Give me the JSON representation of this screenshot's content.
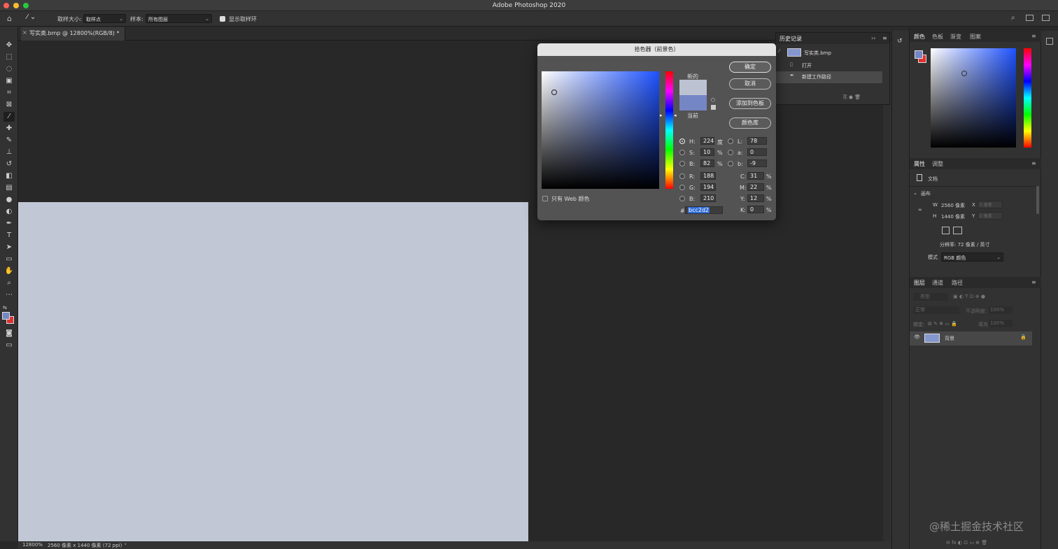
{
  "app": {
    "title": "Adobe Photoshop 2020"
  },
  "options_bar": {
    "sample_size_label": "取样大小:",
    "sample_size_value": "取样点",
    "sample_label": "样本:",
    "sample_value": "所有图层",
    "show_ring_label": "显示取样环"
  },
  "document": {
    "tab_label": "写实类.bmp @ 12800%(RGB/8) *",
    "fill_color": "#c1c7d5"
  },
  "status": {
    "zoom": "12800%",
    "size": "2560 像素 x 1440 像素 (72 ppi)",
    "arrow": "›"
  },
  "history": {
    "title": "历史记录",
    "snapshot": "写实类.bmp",
    "items": [
      {
        "label": "打开"
      },
      {
        "label": "新建工作路径"
      }
    ]
  },
  "color_picker": {
    "title": "拾色器（前景色）",
    "new_label": "新的",
    "current_label": "当前",
    "new_color": "#bcc2d2",
    "current_color": "#7586c5",
    "ok": "确定",
    "cancel": "取消",
    "add_swatch": "添加到色板",
    "color_libraries": "颜色库",
    "web_only": "只有 Web 颜色",
    "fields": {
      "H": {
        "label": "H:",
        "value": "224",
        "unit": "度"
      },
      "S": {
        "label": "S:",
        "value": "10",
        "unit": "%"
      },
      "Bv": {
        "label": "B:",
        "value": "82",
        "unit": "%"
      },
      "R": {
        "label": "R:",
        "value": "188"
      },
      "G": {
        "label": "G:",
        "value": "194"
      },
      "B": {
        "label": "B:",
        "value": "210"
      },
      "L": {
        "label": "L:",
        "value": "78"
      },
      "a": {
        "label": "a:",
        "value": "0"
      },
      "b": {
        "label": "b:",
        "value": "-9"
      },
      "C": {
        "label": "C:",
        "value": "31",
        "unit": "%"
      },
      "M": {
        "label": "M:",
        "value": "22",
        "unit": "%"
      },
      "Y": {
        "label": "Y:",
        "value": "12",
        "unit": "%"
      },
      "K": {
        "label": "K:",
        "value": "0",
        "unit": "%"
      }
    },
    "hash": "#",
    "hex": "bcc2d2"
  },
  "color_panel": {
    "tabs": [
      "颜色",
      "色板",
      "渐变",
      "图案"
    ],
    "fg": "#7586c5",
    "bg": "#e03030"
  },
  "properties": {
    "tabs": [
      "属性",
      "调整"
    ],
    "doc_label": "文档",
    "canvas_label": "画布",
    "w_label": "W",
    "w_value": "2560 像素",
    "x_label": "X",
    "x_placeholder": "0 像素",
    "h_label": "H",
    "h_value": "1440 像素",
    "y_label": "Y",
    "y_placeholder": "0 像素",
    "resolution": "分辨率: 72 像素 / 英寸",
    "mode_label": "模式",
    "mode_value": "RGB 颜色"
  },
  "layers": {
    "tabs": [
      "图层",
      "通道",
      "路径"
    ],
    "filter_placeholder": "类型",
    "blend_mode": "正常",
    "opacity_label": "不透明度:",
    "opacity_value": "100%",
    "lock_label": "锁定:",
    "fill_label": "填充:",
    "fill_value": "100%",
    "layer_name": "背景"
  },
  "watermark": "@稀土掘金技术社区"
}
